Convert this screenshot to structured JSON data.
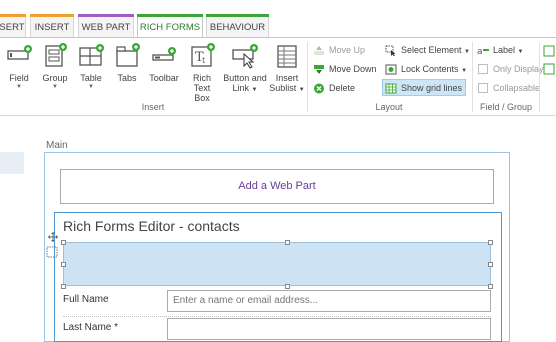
{
  "tabs": [
    {
      "label": "SERT",
      "color": "#f0a030"
    },
    {
      "label": "INSERT",
      "color": "#f0a030"
    },
    {
      "label": "WEB PART",
      "color": "#a05cc8"
    },
    {
      "label": "RICH FORMS",
      "color": "#3aa635",
      "active": true
    },
    {
      "label": "BEHAVIOUR",
      "color": "#3aa635"
    }
  ],
  "ribbon": {
    "insert_group": {
      "label": "Insert",
      "buttons": [
        {
          "label": "Field",
          "icon": "field-icon",
          "dropdown": true
        },
        {
          "label": "Group",
          "icon": "group-icon",
          "dropdown": true
        },
        {
          "label": "Table",
          "icon": "table-icon",
          "dropdown": true
        },
        {
          "label": "Tabs",
          "icon": "tabs-icon"
        },
        {
          "label": "Toolbar",
          "icon": "toolbar-icon"
        },
        {
          "label": "Rich Text",
          "label2": "Box",
          "icon": "rich-text-icon"
        },
        {
          "label": "Button and",
          "label2": "Link",
          "icon": "button-link-icon",
          "dropdown": true
        },
        {
          "label": "Insert",
          "label2": "Sublist",
          "icon": "sublist-icon",
          "dropdown": true
        }
      ]
    },
    "layout_group": {
      "label": "Layout",
      "move_up": "Move Up",
      "move_down": "Move Down",
      "delete": "Delete",
      "select_element": "Select Element",
      "lock_contents": "Lock Contents",
      "show_grid_lines": "Show grid lines"
    },
    "field_group": {
      "label": "Field / Group",
      "label_button": "Label",
      "only_display": "Only Display",
      "collapsable": "Collapsable"
    }
  },
  "page": {
    "zone_label": "Main",
    "add_web_part": "Add a Web Part",
    "editor_title": "Rich Forms Editor - contacts",
    "fields": [
      {
        "label": "Full Name",
        "placeholder": "Enter a name or email address..."
      },
      {
        "label": "Last Name *",
        "placeholder": ""
      }
    ]
  }
}
